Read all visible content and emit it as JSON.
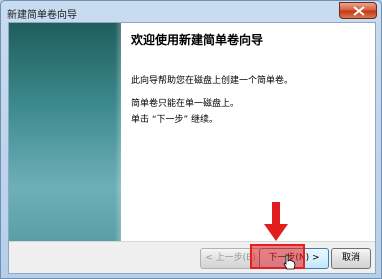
{
  "window": {
    "title": "新建简单卷向导"
  },
  "content": {
    "heading": "欢迎使用新建简单卷向导",
    "paragraph1": "此向导帮助您在磁盘上创建一个简单卷。",
    "paragraph2": "简单卷只能在单一磁盘上。",
    "paragraph3": "单击 “下一步” 继续。"
  },
  "buttons": {
    "back": "< 上一步(B)",
    "next": "下一步(N) >",
    "cancel": "取消"
  },
  "colors": {
    "highlight": "#e61e1e",
    "accent": "#3c7fb1"
  }
}
